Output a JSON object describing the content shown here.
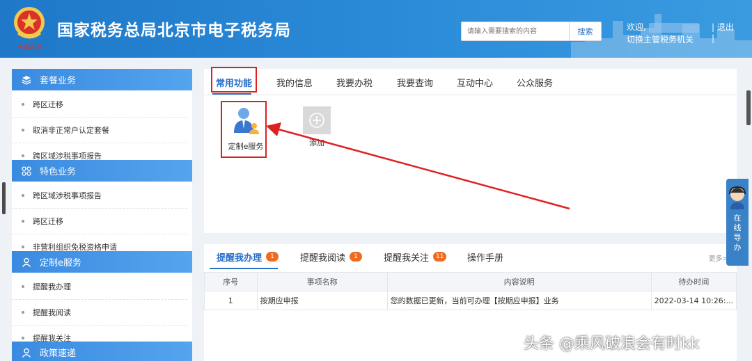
{
  "header": {
    "title": "国家税务总局北京市电子税务局",
    "search_placeholder": "请输入需要搜索的内容",
    "search_button": "搜索",
    "welcome": "欢迎,",
    "divider": "|",
    "logout": "退出",
    "switch_authority": "切换主管税务机关",
    "bg_color": "#2a8ad8"
  },
  "sidebar": {
    "groups": [
      {
        "title": "套餐业务",
        "icon": "layers-icon",
        "items": [
          "跨区迁移",
          "取消非正常户认定套餐",
          "跨区域涉税事项报告"
        ]
      },
      {
        "title": "特色业务",
        "icon": "grid-icon",
        "items": [
          "跨区域涉税事项报告",
          "跨区迁移",
          "非营利组织免税资格申请"
        ]
      },
      {
        "title": "定制e服务",
        "icon": "user-icon",
        "items": [
          "提醒我办理",
          "提醒我阅读",
          "提醒我关注"
        ]
      },
      {
        "title": "政策速递",
        "icon": "user-icon",
        "items": []
      }
    ]
  },
  "main": {
    "tabs": [
      "常用功能",
      "我的信息",
      "我要办税",
      "我要查询",
      "互动中心",
      "公众服务"
    ],
    "functions": [
      {
        "label": "定制e服务",
        "icon": "custom-service-icon"
      },
      {
        "label": "添加",
        "icon": "plus-icon"
      }
    ]
  },
  "reminders": {
    "tabs": [
      {
        "label": "提醒我办理",
        "badge": "1"
      },
      {
        "label": "提醒我阅读",
        "badge": "1"
      },
      {
        "label": "提醒我关注",
        "badge": "11"
      },
      {
        "label": "操作手册",
        "badge": ""
      }
    ],
    "more": "更多>",
    "columns": [
      "序号",
      "事项名称",
      "内容说明",
      "待办时间"
    ],
    "rows": [
      {
        "no": "1",
        "name": "按期应申报",
        "desc": "您的数据已更新，当前可办理【按期应申报】业务",
        "time": "2022-03-14 10:26:..."
      }
    ]
  },
  "online_guide": "在线导办",
  "watermark": "头条 @乘风破浪会有时kk",
  "colors": {
    "accent": "#2a6fc8",
    "highlight": "#e02020",
    "badge": "#f06a20"
  }
}
